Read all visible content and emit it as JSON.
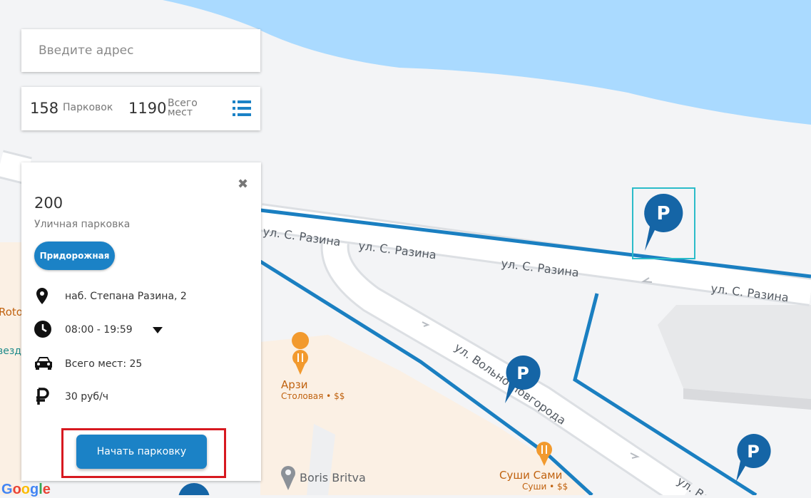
{
  "search": {
    "placeholder": "Введите адрес"
  },
  "stats": {
    "parkings_count": "158",
    "parkings_label": "Парковок",
    "places_count": "1190",
    "places_label_line1": "Всего",
    "places_label_line2": "мест"
  },
  "detail": {
    "id": "200",
    "type": "Уличная парковка",
    "tag": "Придорожная",
    "address": "наб. Степана Разина, 2",
    "hours": "08:00 - 19:59",
    "total_places": "Всего мест: 25",
    "price": "30 руб/ч",
    "start_button": "Начать парковку",
    "close_symbol": "✖"
  },
  "map": {
    "streets": [
      "ул. С. Разина",
      "ул. С. Разина",
      "ул. С. Разина",
      "ул. С. Разина",
      "ул. Вольно Новгорода",
      "ул. Во"
    ],
    "pois": [
      {
        "name": "Арзи",
        "subtitle": "Столовая • $$",
        "icon": "restaurant-icon"
      },
      {
        "name": "Суши Сами",
        "subtitle": "Суши • $$",
        "icon": "restaurant-icon"
      },
      {
        "name": "Boris Britva",
        "icon": "place-pin-icon"
      }
    ],
    "edge_labels": [
      "Roto",
      "везд"
    ],
    "parking_marker_letter": "P",
    "attribution": "Google"
  },
  "colors": {
    "accent": "#1b82c6",
    "marker": "#1565a6",
    "water": "#aadaff",
    "highlight": "#d71920",
    "selected_marker_frame": "#2bbcc9"
  }
}
